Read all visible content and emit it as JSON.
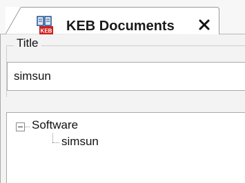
{
  "tab": {
    "title": "KEB Documents",
    "icon": "keb-documents-icon",
    "close_glyph": "✕"
  },
  "form": {
    "title_label": "Title",
    "title_value": "simsun"
  },
  "tree": {
    "root": {
      "label": "Software",
      "expanded": true,
      "children": [
        {
          "label": "simsun"
        }
      ]
    }
  },
  "colors": {
    "accent": "#1f4f8f",
    "icon_red": "#cc1f1f"
  }
}
